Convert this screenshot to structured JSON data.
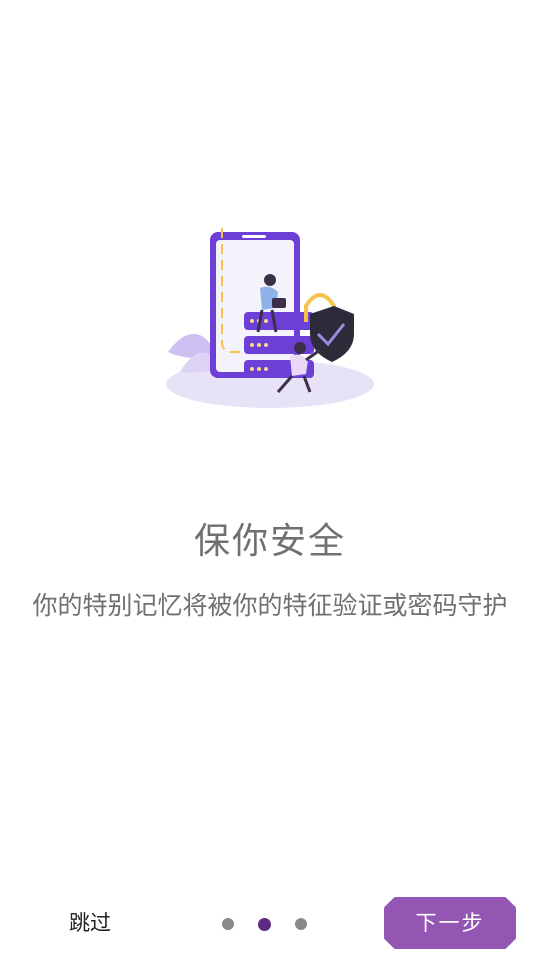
{
  "onboarding": {
    "title": "保你安全",
    "description": "你的特别记忆将被你的特征验证或密码守护",
    "skip_label": "跳过",
    "next_label": "下一步",
    "page_count": 3,
    "current_page": 2
  },
  "illustration": {
    "icon": "security-phone-illustration"
  },
  "colors": {
    "accent": "#9357b3",
    "dot_active": "#5d2a82",
    "dot_inactive": "#8a8a8a",
    "text_gray": "#707070"
  }
}
